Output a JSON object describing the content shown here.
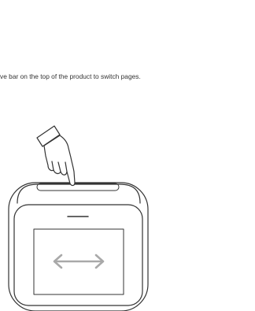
{
  "instruction": {
    "text": "ve bar on the top of the product to switch pages."
  },
  "illustration": {
    "line_color": "#333333",
    "icons": {
      "hand": "hand-pointing-down-icon",
      "arrow": "double-arrow-left-right-icon"
    }
  }
}
